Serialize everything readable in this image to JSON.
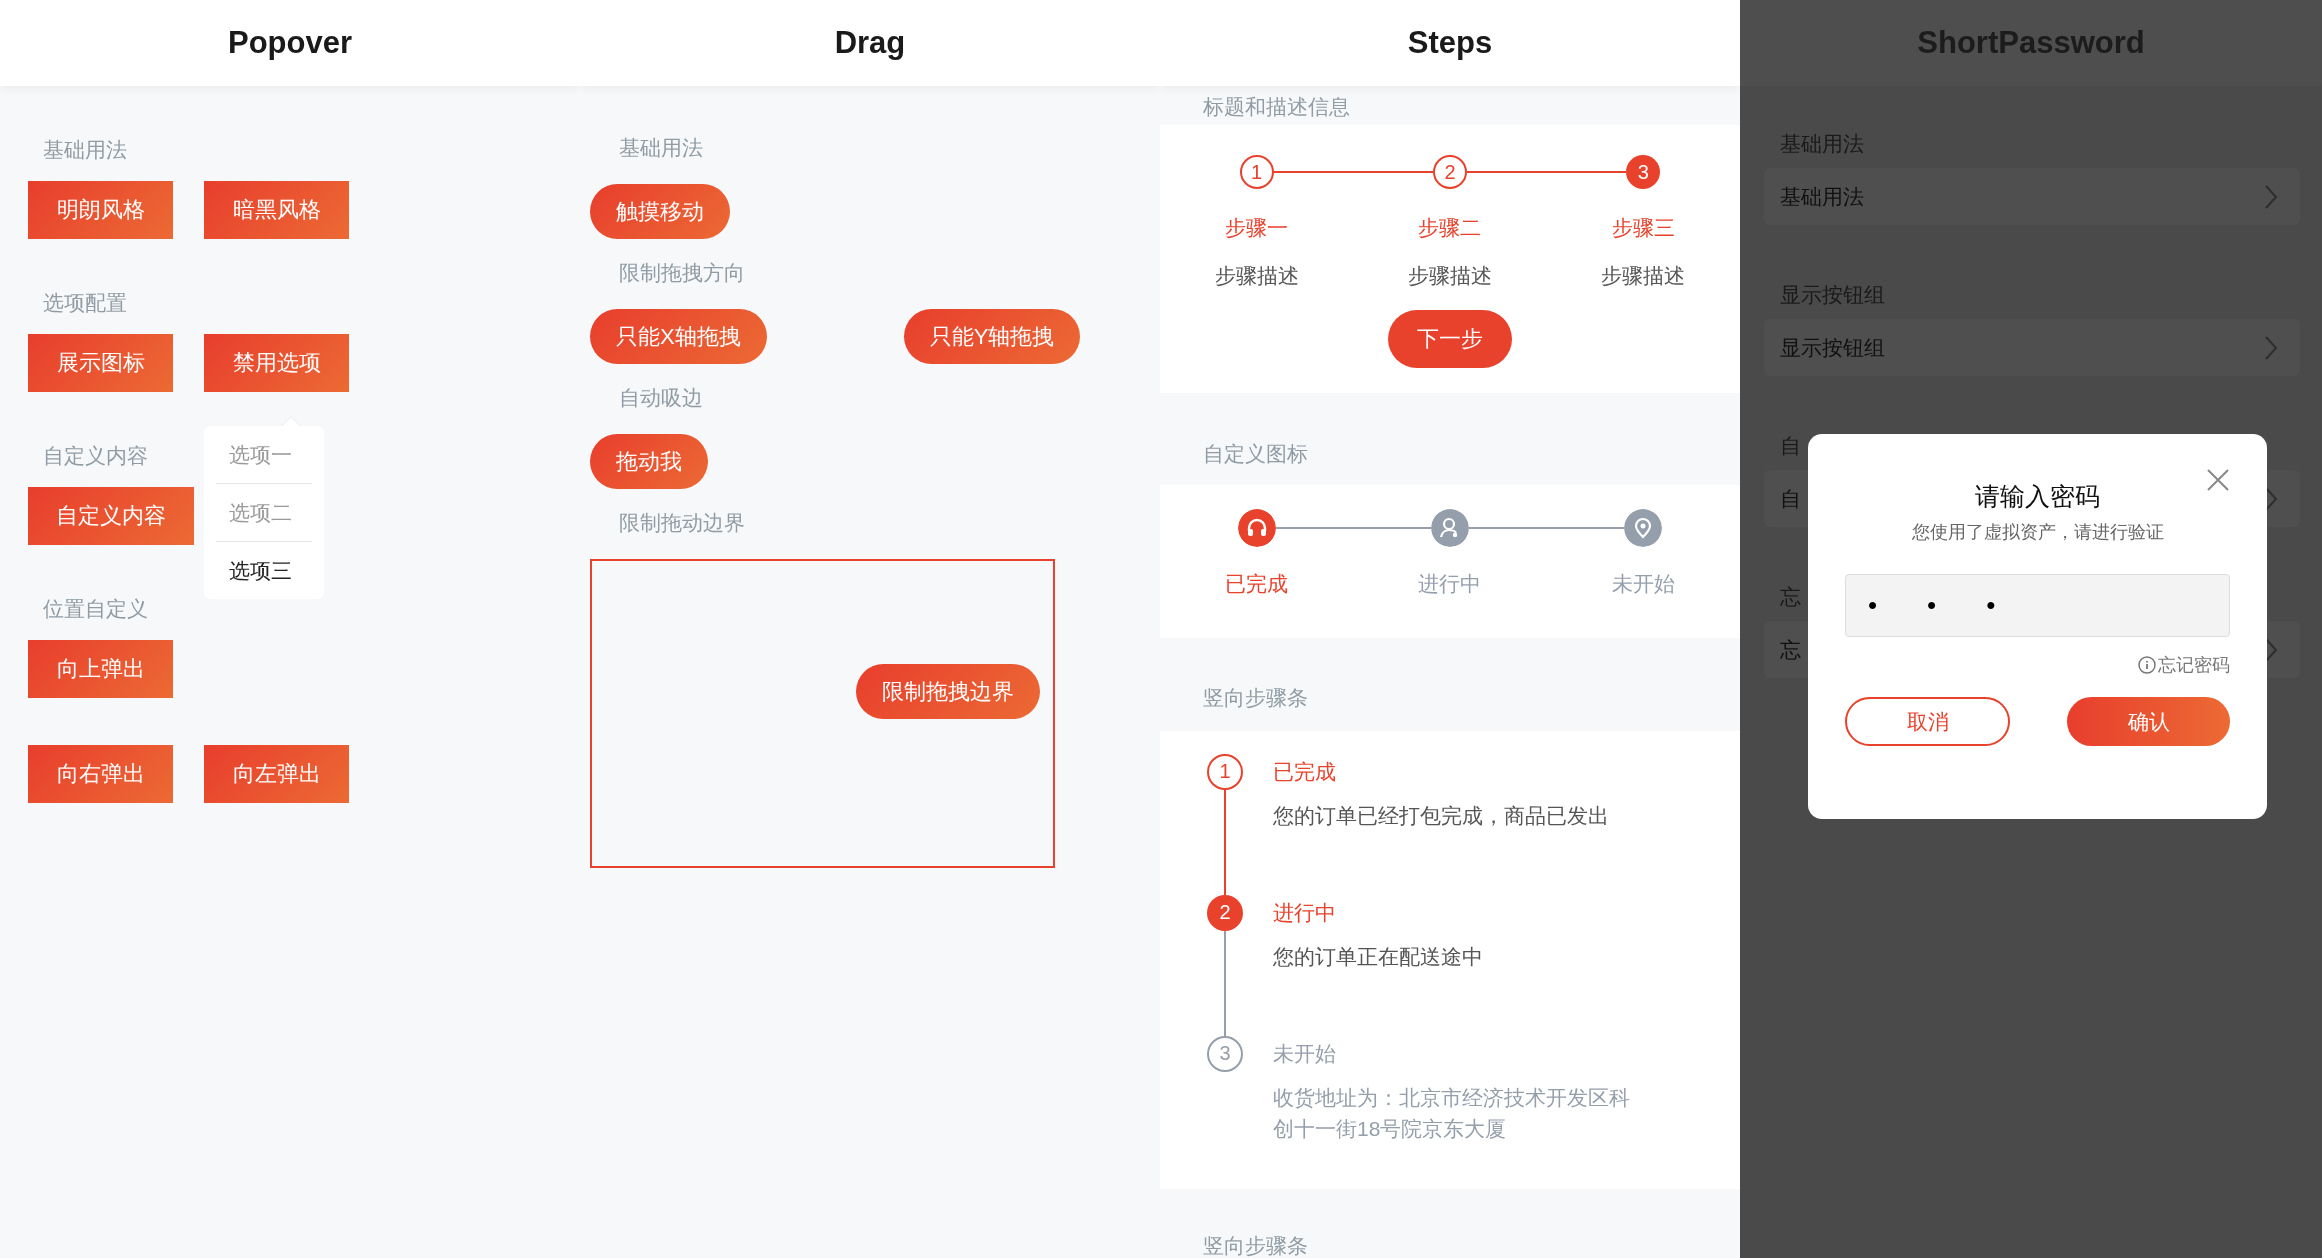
{
  "popover": {
    "title": "Popover",
    "sections": [
      {
        "title": "基础用法",
        "rows": [
          [
            {
              "label": "明朗风格"
            },
            {
              "label": "暗黑风格"
            }
          ]
        ]
      },
      {
        "title": "选项配置",
        "rows": [
          [
            {
              "label": "展示图标"
            },
            {
              "label": "禁用选项",
              "popover": [
                {
                  "label": "选项一",
                  "disabled": true
                },
                {
                  "label": "选项二",
                  "disabled": true
                },
                {
                  "label": "选项三",
                  "disabled": false
                }
              ]
            }
          ]
        ]
      },
      {
        "title": "自定义内容",
        "rows": [
          [
            {
              "label": "自定义内容"
            }
          ]
        ]
      },
      {
        "title": "位置自定义",
        "rows": [
          [
            {
              "label": "向上弹出"
            }
          ],
          [
            {
              "label": "向右弹出"
            },
            {
              "label": "向左弹出"
            }
          ]
        ]
      }
    ]
  },
  "drag": {
    "title": "Drag",
    "sections": [
      {
        "kind": "buttons",
        "title": "基础用法",
        "buttons": [
          "触摸移动"
        ]
      },
      {
        "kind": "spread",
        "title": "限制拖拽方向",
        "buttons": [
          "只能X轴拖拽",
          "只能Y轴拖拽"
        ]
      },
      {
        "kind": "buttons",
        "title": "自动吸边",
        "buttons": [
          "拖动我"
        ]
      },
      {
        "kind": "boundary",
        "title": "限制拖动边界",
        "buttons": [
          "限制拖拽边界"
        ]
      }
    ]
  },
  "steps": {
    "title": "Steps",
    "sections": [
      {
        "kind": "horizontal",
        "title": "标题和描述信息",
        "button": "下一步",
        "items": [
          {
            "number": "1",
            "title": "步骤一",
            "description": "步骤描述",
            "done": true,
            "current": false
          },
          {
            "number": "2",
            "title": "步骤二",
            "description": "步骤描述",
            "done": true,
            "current": false
          },
          {
            "number": "3",
            "title": "步骤三",
            "description": "步骤描述",
            "done": false,
            "current": true
          }
        ]
      },
      {
        "kind": "icons",
        "title": "自定义图标",
        "items": [
          {
            "title": "已完成",
            "done": true
          },
          {
            "title": "进行中",
            "done": false
          },
          {
            "title": "未开始",
            "done": false
          }
        ]
      },
      {
        "kind": "vertical",
        "title": "竖向步骤条",
        "items": [
          {
            "number": "1",
            "title": "已完成",
            "description": "您的订单已经打包完成，商品已发出",
            "done": true,
            "current": false
          },
          {
            "number": "2",
            "title": "进行中",
            "description": "您的订单正在配送途中",
            "done": false,
            "current": true
          },
          {
            "number": "3",
            "title": "未开始",
            "description": "收货地址为：北京市经济技术开发区科创十一街18号院京东大厦",
            "done": false,
            "current": false
          }
        ]
      },
      {
        "kind": "cut",
        "title": "竖向步骤条"
      }
    ]
  },
  "short_password": {
    "title": "ShortPassword",
    "sections": [
      {
        "title": "基础用法",
        "cell": "基础用法"
      },
      {
        "title": "显示按钮组",
        "cell": "显示按钮组"
      },
      {
        "title": "自",
        "cell": "自"
      },
      {
        "title": "忘",
        "cell": "忘"
      }
    ],
    "dialog": {
      "title": "请输入密码",
      "subtitle": "您使用了虚拟资产，请进行验证",
      "value": "•••",
      "forget": "忘记密码",
      "cancel": "取消",
      "confirm": "确认"
    }
  }
}
